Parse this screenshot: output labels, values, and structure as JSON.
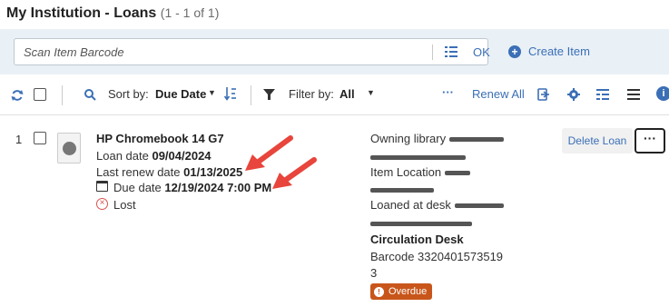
{
  "header": {
    "title": "My Institution - Loans",
    "count": "(1 - 1 of 1)"
  },
  "scan": {
    "placeholder": "Scan Item Barcode",
    "ok_label": "OK",
    "create_item_label": "Create Item"
  },
  "toolbar": {
    "sort_label": "Sort by:",
    "sort_value": "Due Date",
    "filter_label": "Filter by:",
    "filter_value": "All",
    "ellipsis": "···",
    "renew_all_label": "Renew All"
  },
  "loan": {
    "row_number": "1",
    "title": "HP Chromebook 14 G7",
    "loan_date_label": "Loan date",
    "loan_date": "09/04/2024",
    "last_renew_label": "Last renew date",
    "last_renew_date": "01/13/2025",
    "due_date_label": "Due date",
    "due_date": "12/19/2024 7:00 PM",
    "status": "Lost",
    "owning_library_label": "Owning library",
    "item_location_label": "Item Location",
    "loaned_at_desk_label": "Loaned at desk",
    "circulation_desk": "Circulation Desk",
    "barcode_label": "Barcode",
    "barcode_line1": "3320401573519",
    "barcode_line2": "3",
    "overdue_badge": "Overdue",
    "delete_label": "Delete Loan",
    "more_label": "···"
  },
  "colors": {
    "accent": "#3b6fb6",
    "overdue": "#c8561b",
    "lost": "#d9534f",
    "arrow": "#e8453c"
  }
}
